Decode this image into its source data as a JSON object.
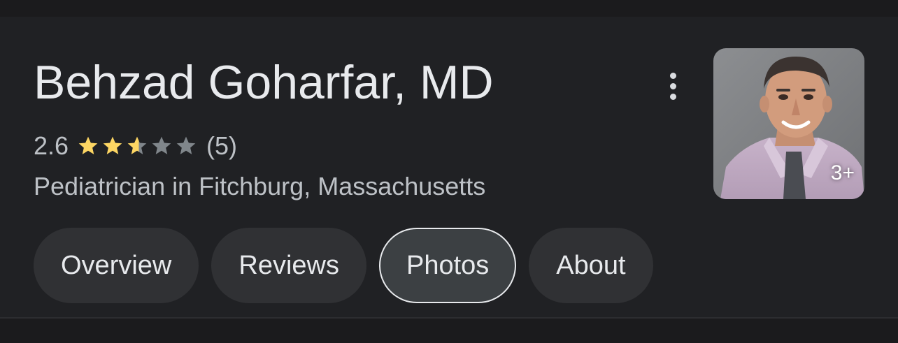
{
  "profile": {
    "name": "Behzad Goharfar, MD",
    "rating": "2.6",
    "rating_stars": 2.6,
    "rating_max": 5,
    "review_count": "(5)",
    "category": "Pediatrician in Fitchburg, Massachusetts"
  },
  "photo": {
    "count_label": "3+"
  },
  "menu": {
    "icon": "more-vert-icon"
  },
  "tabs": [
    {
      "label": "Overview",
      "selected": false
    },
    {
      "label": "Reviews",
      "selected": false
    },
    {
      "label": "Photos",
      "selected": true
    },
    {
      "label": "About",
      "selected": false
    }
  ],
  "colors": {
    "background": "#202124",
    "star_filled": "#fdd663",
    "star_empty": "#80868b",
    "tab_bg": "#303134",
    "tab_selected_border": "#e8eaed"
  }
}
